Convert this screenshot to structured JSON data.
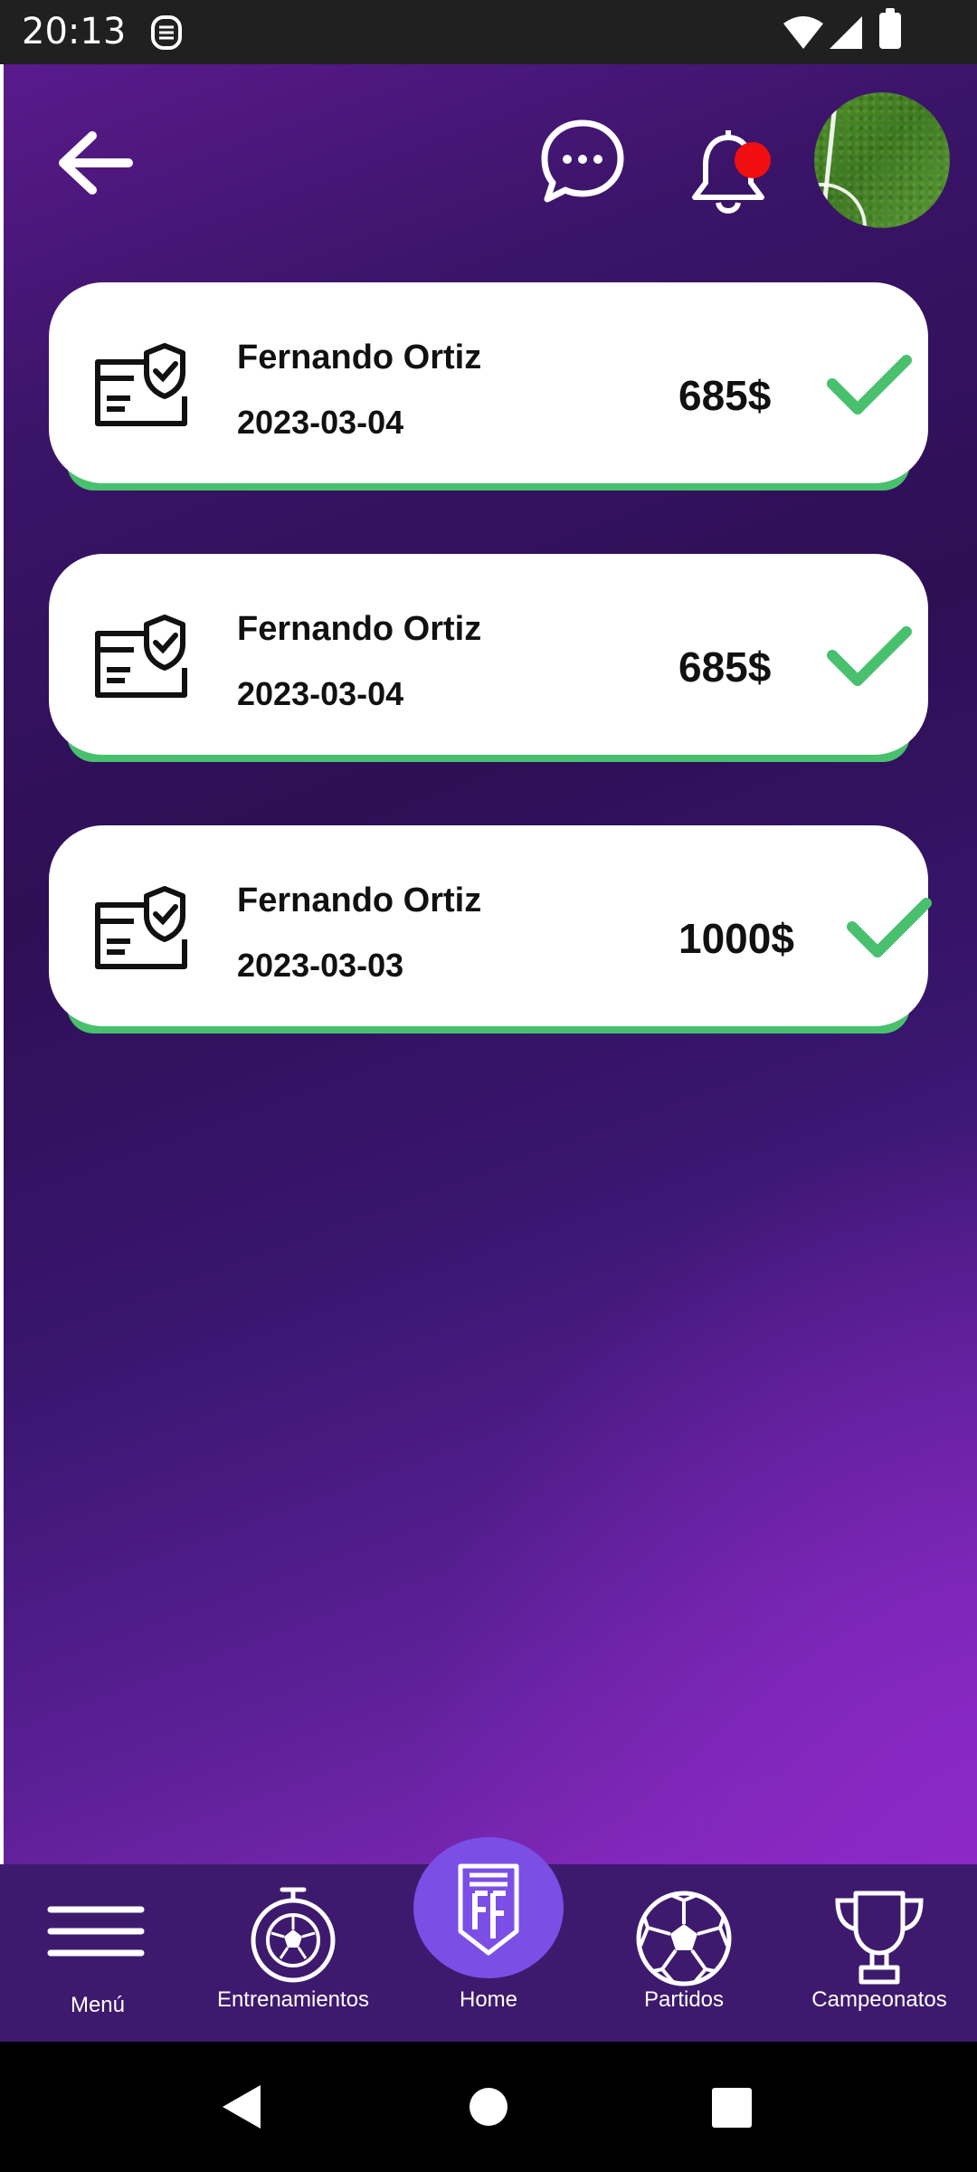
{
  "status_bar": {
    "time": "20:13"
  },
  "header": {
    "back_icon": "arrow-left-icon",
    "chat_icon": "chat-bubble-icon",
    "bell_icon": "bell-icon",
    "accent_notification": "#f00e0e"
  },
  "payments": [
    {
      "name": "Fernando Ortiz",
      "date": "2023-03-04",
      "amount": "685$",
      "status_icon": "check-icon"
    },
    {
      "name": "Fernando Ortiz",
      "date": "2023-03-04",
      "amount": "685$",
      "status_icon": "check-icon"
    },
    {
      "name": "Fernando Ortiz",
      "date": "2023-03-03",
      "amount": "1000$",
      "status_icon": "check-icon"
    }
  ],
  "colors": {
    "success": "#48c06e",
    "nav_background": "#3e1a6e",
    "home_accent": "#7b4ee6"
  },
  "bottom_nav": {
    "items": [
      {
        "label": "Menú",
        "icon": "hamburger-menu-icon"
      },
      {
        "label": "Entrenamientos",
        "icon": "stopwatch-ball-icon"
      },
      {
        "label": "Home",
        "icon": "brand-logo-icon"
      },
      {
        "label": "Partidos",
        "icon": "soccer-ball-icon"
      },
      {
        "label": "Campeonatos",
        "icon": "trophy-icon"
      }
    ]
  }
}
